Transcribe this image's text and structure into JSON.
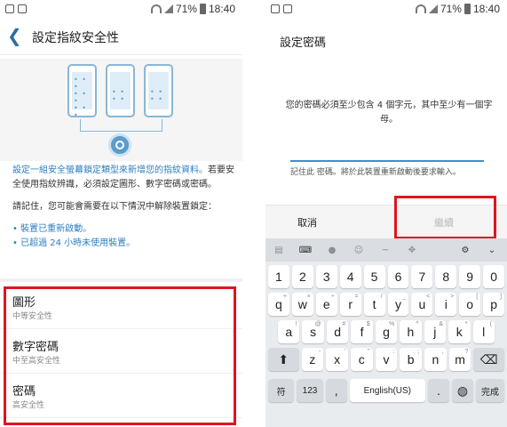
{
  "status": {
    "battery_pct": "71%",
    "time": "18:40"
  },
  "screen1": {
    "title": "設定指紋安全性",
    "intro": "設定一組安全螢幕鎖定類型來新增您的指紋資料。",
    "intro2": "若要安全使用指紋辨識，必須設定圖形、數字密碼或密碼。",
    "note": "請記住，您可能會需要在以下情況中解除裝置鎖定：",
    "bullets": [
      "• 裝置已重新啟動。",
      "• 已超過 24 小時未使用裝置。"
    ],
    "options": [
      {
        "title": "圖形",
        "sub": "中等安全性"
      },
      {
        "title": "數字密碼",
        "sub": "中至高安全性"
      },
      {
        "title": "密碼",
        "sub": "高安全性"
      }
    ]
  },
  "screen2": {
    "title": "設定密碼",
    "message": "您的密碼必須至少包含 4 個字元，其中至少有一個字母。",
    "hint": "記住此 密碼。將於此裝置重新啟動後要求輸入。",
    "cancel": "取消",
    "continue": "繼續"
  },
  "keyboard": {
    "row_num": [
      "1",
      "2",
      "3",
      "4",
      "5",
      "6",
      "7",
      "8",
      "9",
      "0"
    ],
    "row1": [
      "q",
      "w",
      "e",
      "r",
      "t",
      "y",
      "u",
      "i",
      "o",
      "p"
    ],
    "row2": [
      "a",
      "s",
      "d",
      "f",
      "g",
      "h",
      "j",
      "k",
      "l"
    ],
    "row3": [
      "z",
      "x",
      "c",
      "v",
      "b",
      "n",
      "m"
    ],
    "sym_key": "符",
    "num_key": "123",
    "comma": ",",
    "space": "English(US)",
    "period": ".",
    "done": "完成"
  }
}
